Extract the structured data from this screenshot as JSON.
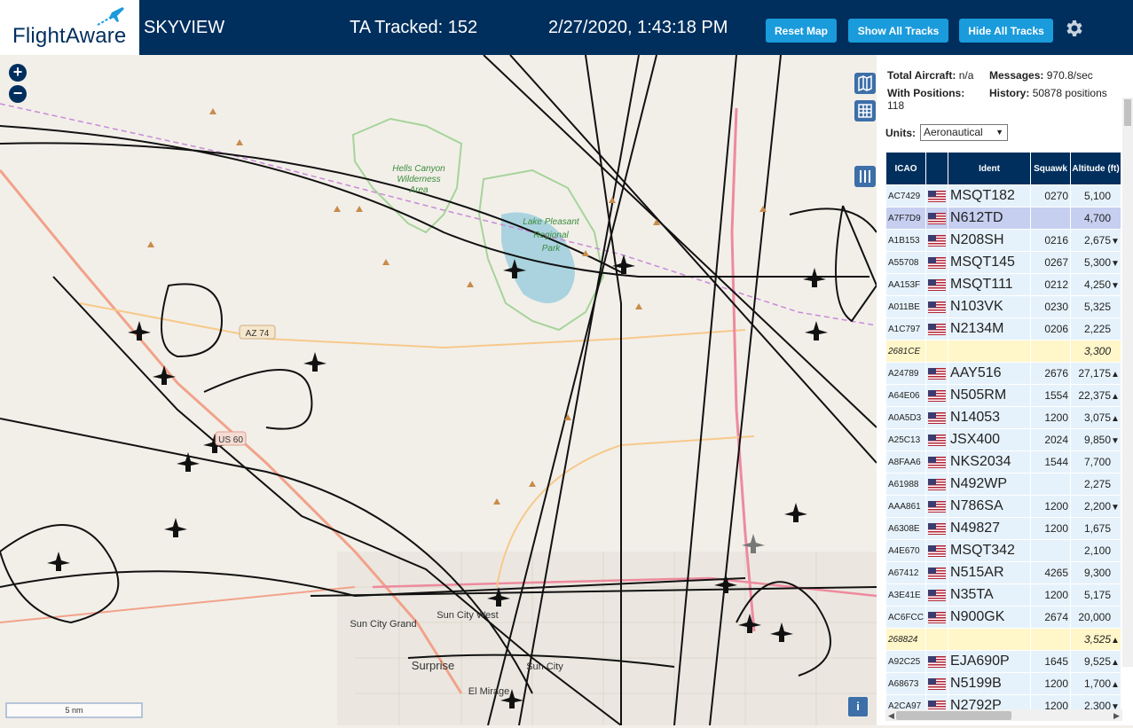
{
  "header": {
    "logo_text": "FlightAware",
    "app_name": "SKYVIEW",
    "tracked": "TA Tracked: 152",
    "datetime": "2/27/2020, 1:43:18 PM",
    "buttons": {
      "reset": "Reset Map",
      "show": "Show All Tracks",
      "hide": "Hide All Tracks"
    }
  },
  "map": {
    "labels": {
      "hells_canyon": "Hells Canyon",
      "wilderness": "Wilderness",
      "area": "Area",
      "lake_pleasant": "Lake Pleasant",
      "regional": "Regional",
      "park": "Park",
      "az74": "AZ 74",
      "us60": "US 60",
      "sun_city_west": "Sun City West",
      "sun_city_grand": "Sun City Grand",
      "surprise": "Surprise",
      "sun_city": "Sun City",
      "el_mirage": "El Mirage"
    },
    "scale": "5 nm",
    "info": "i"
  },
  "sidebar": {
    "stats": {
      "total_label": "Total Aircraft:",
      "total_value": "n/a",
      "messages_label": "Messages:",
      "messages_value": "970.8/sec",
      "positions_label": "With Positions:",
      "positions_value": "118",
      "history_label": "History:",
      "history_value": "50878 positions"
    },
    "units_label": "Units:",
    "units_value": "Aeronautical",
    "columns": {
      "icao": "ICAO",
      "ident": "Ident",
      "squawk": "Squawk",
      "altitude": "Altitude (ft)"
    },
    "rows": [
      {
        "icao": "AC7429",
        "flag": true,
        "ident": "MSQT182",
        "squawk": "0270",
        "alt": "5,100",
        "trend": "",
        "type": "r"
      },
      {
        "icao": "A7F7D9",
        "flag": true,
        "ident": "N612TD",
        "squawk": "",
        "alt": "4,700",
        "trend": "",
        "type": "sel"
      },
      {
        "icao": "A1B153",
        "flag": true,
        "ident": "N208SH",
        "squawk": "0216",
        "alt": "2,675",
        "trend": "▼",
        "type": "r"
      },
      {
        "icao": "A55708",
        "flag": true,
        "ident": "MSQT145",
        "squawk": "0267",
        "alt": "5,300",
        "trend": "▼",
        "type": "r"
      },
      {
        "icao": "AA153F",
        "flag": true,
        "ident": "MSQT111",
        "squawk": "0212",
        "alt": "4,250",
        "trend": "▼",
        "type": "r"
      },
      {
        "icao": "A011BE",
        "flag": true,
        "ident": "N103VK",
        "squawk": "0230",
        "alt": "5,325",
        "trend": "",
        "type": "r"
      },
      {
        "icao": "A1C797",
        "flag": true,
        "ident": "N2134M",
        "squawk": "0206",
        "alt": "2,225",
        "trend": "",
        "type": "r"
      },
      {
        "icao": "2681CE",
        "flag": false,
        "ident": "",
        "squawk": "",
        "alt": "3,300",
        "trend": "",
        "type": "nopos"
      },
      {
        "icao": "A24789",
        "flag": true,
        "ident": "AAY516",
        "squawk": "2676",
        "alt": "27,175",
        "trend": "▲",
        "type": "r"
      },
      {
        "icao": "A64E06",
        "flag": true,
        "ident": "N505RM",
        "squawk": "1554",
        "alt": "22,375",
        "trend": "▲",
        "type": "r"
      },
      {
        "icao": "A0A5D3",
        "flag": true,
        "ident": "N14053",
        "squawk": "1200",
        "alt": "3,075",
        "trend": "▲",
        "type": "r"
      },
      {
        "icao": "A25C13",
        "flag": true,
        "ident": "JSX400",
        "squawk": "2024",
        "alt": "9,850",
        "trend": "▼",
        "type": "r"
      },
      {
        "icao": "A8FAA6",
        "flag": true,
        "ident": "NKS2034",
        "squawk": "1544",
        "alt": "7,700",
        "trend": "",
        "type": "r"
      },
      {
        "icao": "A61988",
        "flag": true,
        "ident": "N492WP",
        "squawk": "",
        "alt": "2,275",
        "trend": "",
        "type": "r"
      },
      {
        "icao": "AAA861",
        "flag": true,
        "ident": "N786SA",
        "squawk": "1200",
        "alt": "2,200",
        "trend": "▼",
        "type": "r"
      },
      {
        "icao": "A6308E",
        "flag": true,
        "ident": "N49827",
        "squawk": "1200",
        "alt": "1,675",
        "trend": "",
        "type": "r"
      },
      {
        "icao": "A4E670",
        "flag": true,
        "ident": "MSQT342",
        "squawk": "",
        "alt": "2,100",
        "trend": "",
        "type": "r"
      },
      {
        "icao": "A67412",
        "flag": true,
        "ident": "N515AR",
        "squawk": "4265",
        "alt": "9,300",
        "trend": "",
        "type": "r"
      },
      {
        "icao": "A3E41E",
        "flag": true,
        "ident": "N35TA",
        "squawk": "1200",
        "alt": "5,175",
        "trend": "",
        "type": "r"
      },
      {
        "icao": "AC6FCC",
        "flag": true,
        "ident": "N900GK",
        "squawk": "2674",
        "alt": "20,000",
        "trend": "",
        "type": "r"
      },
      {
        "icao": "268824",
        "flag": false,
        "ident": "",
        "squawk": "",
        "alt": "3,525",
        "trend": "▲",
        "type": "nopos"
      },
      {
        "icao": "A92C25",
        "flag": true,
        "ident": "EJA690P",
        "squawk": "1645",
        "alt": "9,525",
        "trend": "▲",
        "type": "r"
      },
      {
        "icao": "A68673",
        "flag": true,
        "ident": "N5199B",
        "squawk": "1200",
        "alt": "1,700",
        "trend": "▲",
        "type": "r"
      },
      {
        "icao": "A2CA97",
        "flag": true,
        "ident": "N2792P",
        "squawk": "1200",
        "alt": "2,300",
        "trend": "▼",
        "type": "r"
      }
    ]
  },
  "colors": {
    "header_bg": "#002f5d",
    "button_bg": "#1a9bdc",
    "row_bg": "#e6f2fb",
    "selected_row": "#c6cff0",
    "nopos_row": "#fff6c9"
  }
}
